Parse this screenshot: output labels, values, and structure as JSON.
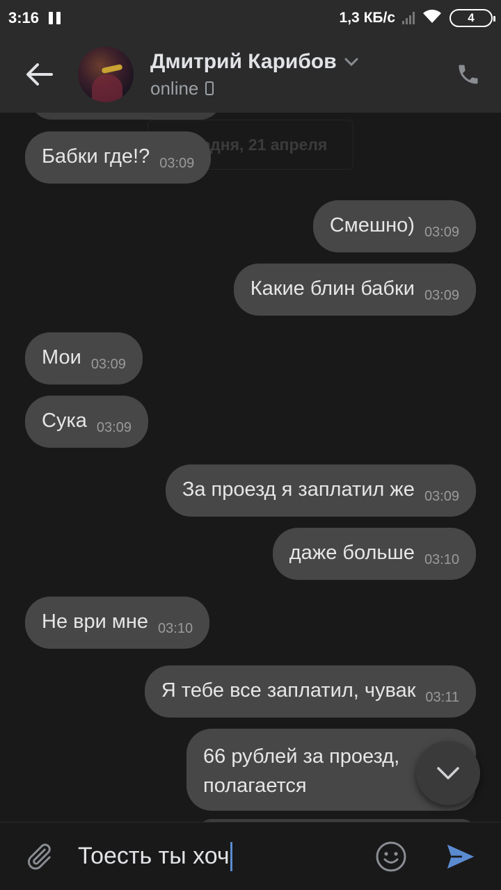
{
  "status_bar": {
    "time": "3:16",
    "network_speed": "1,3 КБ/с",
    "battery_level": "4"
  },
  "header": {
    "peer_name": "Дмитрий Карибов",
    "peer_status": "online"
  },
  "feed": {
    "date_separator": "Сегодня, 21 апреля",
    "messages": [
      {
        "direction": "incoming",
        "text": "Бабки где!?",
        "time": "03:09"
      },
      {
        "direction": "outgoing",
        "text": "Смешно)",
        "time": "03:09"
      },
      {
        "direction": "outgoing",
        "text": "Какие блин бабки",
        "time": "03:09"
      },
      {
        "direction": "incoming",
        "text": "Мои",
        "time": "03:09"
      },
      {
        "direction": "incoming",
        "text": "Сука",
        "time": "03:09"
      },
      {
        "direction": "outgoing",
        "text": "За проезд я заплатил же",
        "time": "03:09"
      },
      {
        "direction": "outgoing",
        "text": "даже больше",
        "time": "03:10"
      },
      {
        "direction": "incoming",
        "text": "Не ври мне",
        "time": "03:10"
      },
      {
        "direction": "outgoing",
        "text": "Я тебе все заплатил, чувак",
        "time": "03:11"
      },
      {
        "direction": "outgoing",
        "line1": "66 рублей за проезд,",
        "line2": "полагается"
      }
    ]
  },
  "composer": {
    "draft_text": "Тоесть ты хоч"
  },
  "colors": {
    "background": "#191919",
    "header": "#2b2b2b",
    "bubble": "#474747",
    "accent": "#5a8bd0"
  },
  "icons": [
    "back-arrow-icon",
    "chevron-down-icon",
    "phone-icon",
    "attach-icon",
    "emoji-icon",
    "send-icon"
  ]
}
